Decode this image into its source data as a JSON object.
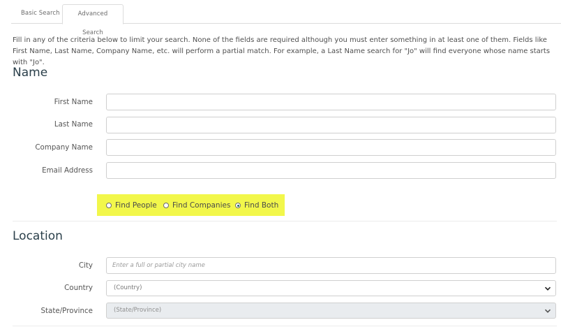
{
  "tabs": [
    {
      "label": "Basic Search"
    },
    {
      "label": "Advanced Search"
    }
  ],
  "intro": "Fill in any of the criteria below to limit your search. None of the fields are required although you must enter something in at least one of them. Fields like First Name, Last Name, Company Name, etc. will perform a partial match. For example, a Last Name search for \"Jo\" will find everyone whose name starts with \"Jo\".",
  "name_section": {
    "title": "Name",
    "fields": [
      {
        "label": "First Name",
        "value": ""
      },
      {
        "label": "Last Name",
        "value": ""
      },
      {
        "label": "Company Name",
        "value": ""
      },
      {
        "label": "Email Address",
        "value": ""
      }
    ],
    "find_options": [
      {
        "label": "Find People",
        "checked": false
      },
      {
        "label": "Find Companies",
        "checked": false
      },
      {
        "label": "Find Both",
        "checked": true
      }
    ],
    "highlight_color": "#f2f74b"
  },
  "location_section": {
    "title": "Location",
    "city_label": "City",
    "city_placeholder": "Enter a full or partial city name",
    "country_label": "Country",
    "country_value": "(Country)",
    "state_label": "State/Province",
    "state_value": "(State/Province)"
  }
}
